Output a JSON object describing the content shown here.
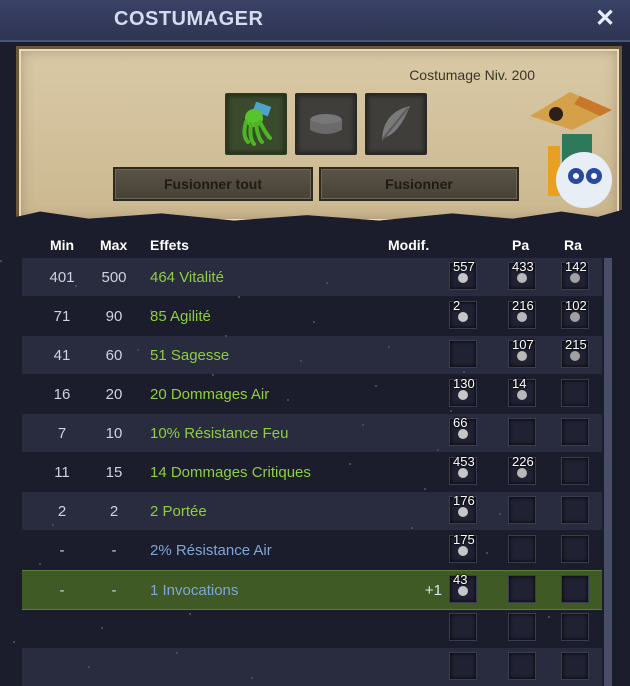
{
  "window": {
    "title": "COSTUMAGER",
    "close_icon": "close-icon"
  },
  "panel": {
    "level_text": "Costumage Niv. 200",
    "slots": [
      {
        "name": "squid-item-icon",
        "filled": true
      },
      {
        "name": "hat-slot-icon",
        "filled": false
      },
      {
        "name": "feather-slot-icon",
        "filled": false
      }
    ],
    "buttons": {
      "fuse_all": "Fusionner tout",
      "fuse": "Fusionner"
    }
  },
  "table": {
    "headers": {
      "min": "Min",
      "max": "Max",
      "effects": "Effets",
      "modif": "Modif.",
      "pa": "Pa",
      "ra": "Ra"
    },
    "rows": [
      {
        "min": "401",
        "max": "500",
        "effect": "464 Vitalité",
        "color": "green",
        "modif": "",
        "runes": [
          "557",
          "433",
          "142"
        ]
      },
      {
        "min": "71",
        "max": "90",
        "effect": "85 Agilité",
        "color": "green",
        "modif": "",
        "runes": [
          "2",
          "216",
          "102"
        ]
      },
      {
        "min": "41",
        "max": "60",
        "effect": "51 Sagesse",
        "color": "green",
        "modif": "",
        "runes": [
          "",
          "107",
          "215"
        ]
      },
      {
        "min": "16",
        "max": "20",
        "effect": "20 Dommages Air",
        "color": "green",
        "modif": "",
        "runes": [
          "130",
          "14",
          ""
        ]
      },
      {
        "min": "7",
        "max": "10",
        "effect": "10% Résistance Feu",
        "color": "green",
        "modif": "",
        "runes": [
          "66",
          "",
          ""
        ]
      },
      {
        "min": "11",
        "max": "15",
        "effect": "14 Dommages Critiques",
        "color": "green",
        "modif": "",
        "runes": [
          "453",
          "226",
          ""
        ]
      },
      {
        "min": "2",
        "max": "2",
        "effect": "2 Portée",
        "color": "green",
        "modif": "",
        "runes": [
          "176",
          "",
          ""
        ]
      },
      {
        "min": "-",
        "max": "-",
        "effect": "2% Résistance Air",
        "color": "blue",
        "modif": "",
        "runes": [
          "175",
          "",
          ""
        ]
      },
      {
        "min": "-",
        "max": "-",
        "effect": "1 Invocations",
        "color": "blue",
        "modif": "+1",
        "runes": [
          "43",
          "",
          ""
        ]
      },
      {
        "min": "",
        "max": "",
        "effect": "",
        "color": "",
        "modif": "",
        "runes": [
          "",
          "",
          ""
        ]
      },
      {
        "min": "",
        "max": "",
        "effect": "",
        "color": "",
        "modif": "",
        "runes": [
          "",
          "",
          ""
        ]
      }
    ],
    "selected_row": 8
  },
  "colors": {
    "effect_green": "#8ecf3e",
    "effect_blue": "#7fa6d8",
    "selected_row": "#3f5a25"
  }
}
